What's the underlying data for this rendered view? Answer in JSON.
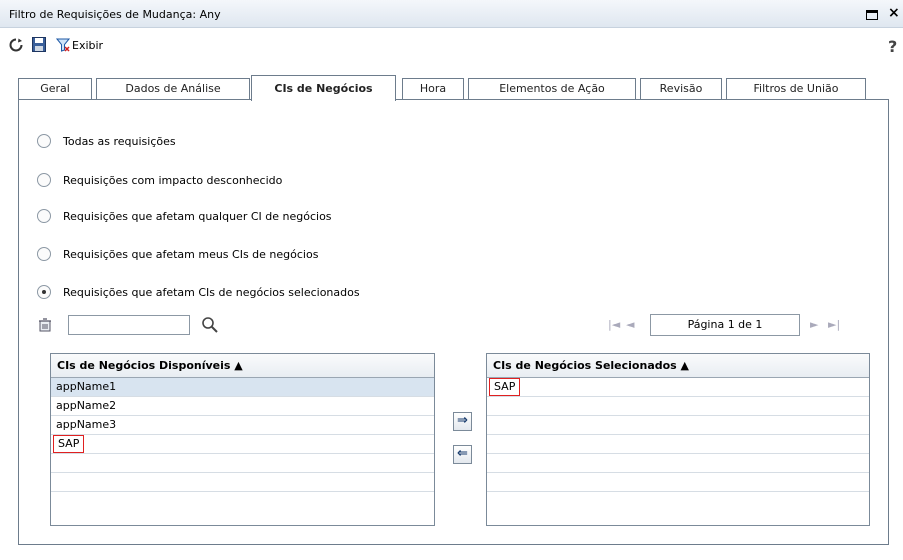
{
  "window": {
    "title": "Filtro de Requisições de Mudança: Any"
  },
  "toolbar": {
    "exibir_label": "Exibir",
    "help_label": "?"
  },
  "tabs": [
    {
      "label": "Geral"
    },
    {
      "label": "Dados de Análise"
    },
    {
      "label": "CIs de Negócios"
    },
    {
      "label": "Hora"
    },
    {
      "label": "Elementos de Ação"
    },
    {
      "label": "Revisão"
    },
    {
      "label": "Filtros de União"
    }
  ],
  "options": [
    {
      "label": "Todas as requisições",
      "checked": false
    },
    {
      "label": "Requisições com impacto desconhecido",
      "checked": false
    },
    {
      "label": "Requisições que afetam qualquer CI de negócios",
      "checked": false
    },
    {
      "label": "Requisições que afetam meus CIs de negócios",
      "checked": false
    },
    {
      "label": "Requisições que afetam CIs de negócios selecionados",
      "checked": true
    }
  ],
  "search": {
    "value": ""
  },
  "pager": {
    "first": "|◄",
    "prev": "◄",
    "label": "Página 1 de 1",
    "next": "►",
    "last": "►|"
  },
  "available": {
    "header": "CIs de Negócios Disponíveis ▲",
    "items": [
      "appName1",
      "appName2",
      "appName3",
      "SAP"
    ]
  },
  "selected": {
    "header": "CIs de Negócios Selecionados ▲",
    "items": [
      "SAP"
    ]
  },
  "buttons": {
    "add": "⇒",
    "remove": "⇐"
  }
}
